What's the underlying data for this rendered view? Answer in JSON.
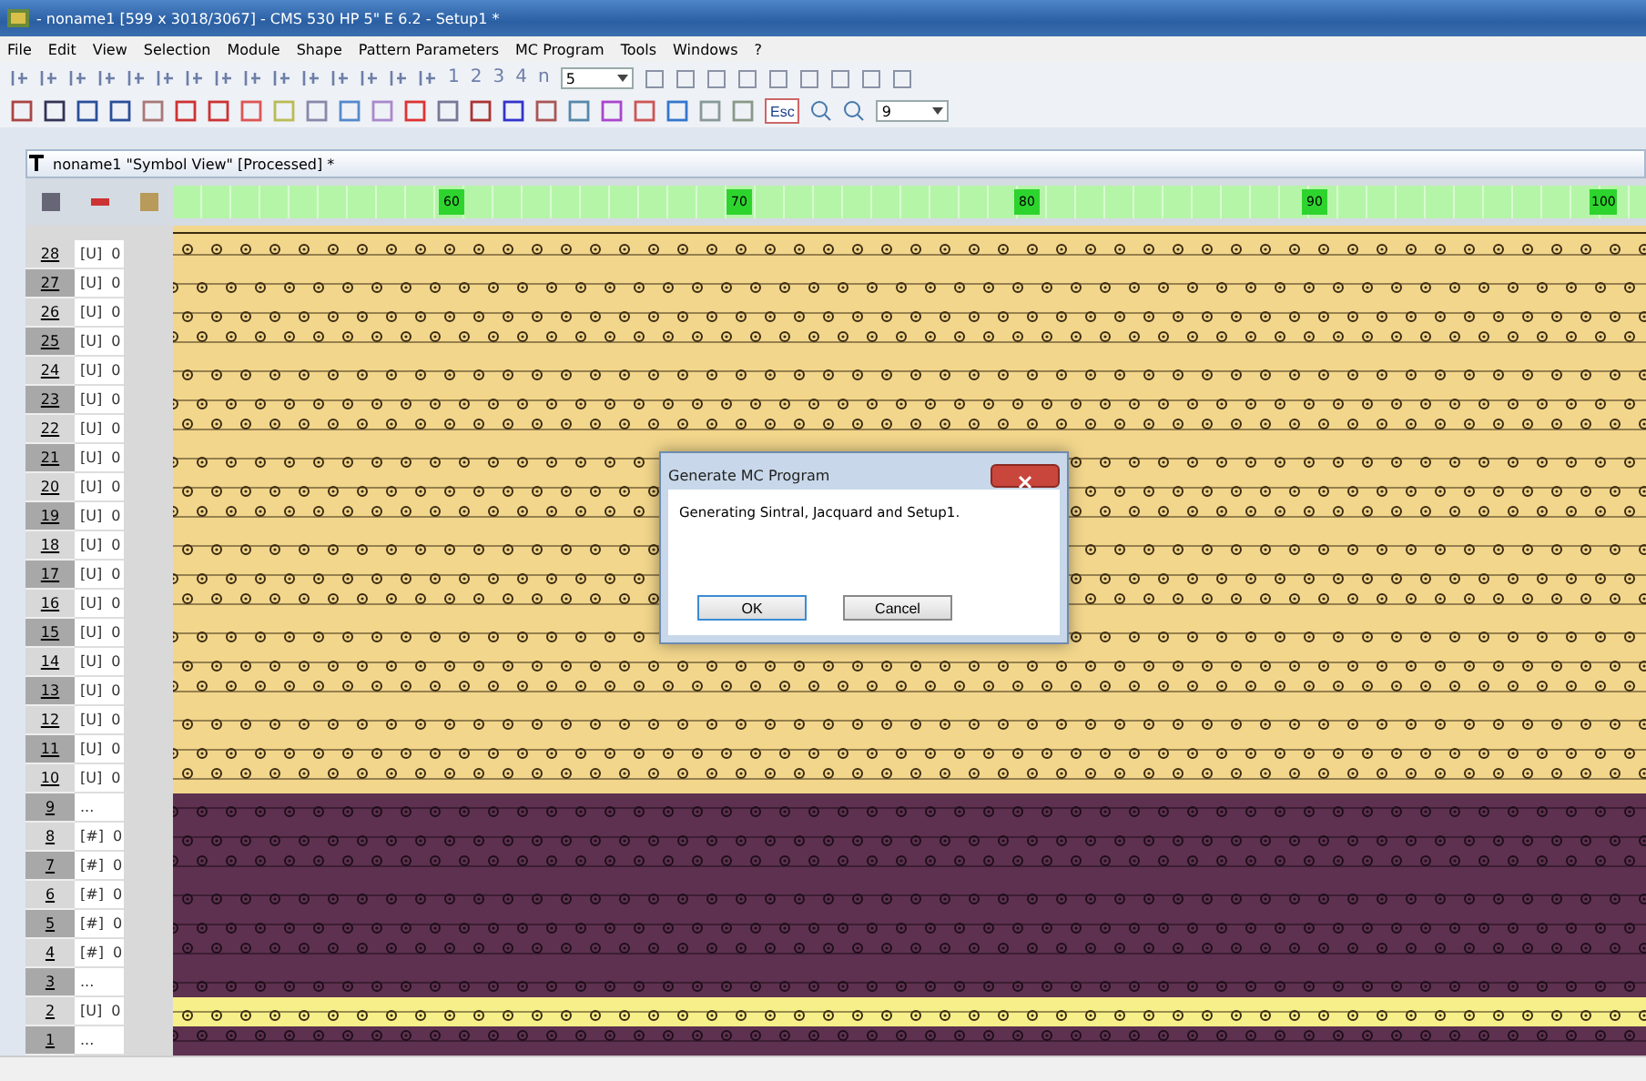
{
  "window": {
    "title": "- noname1 [599 x 3018/3067] - CMS 530 HP 5\" E 6.2 - Setup1 *"
  },
  "menu": [
    "File",
    "Edit",
    "View",
    "Selection",
    "Module",
    "Shape",
    "Pattern Parameters",
    "MC Program",
    "Tools",
    "Windows",
    "?"
  ],
  "toolbar_1": {
    "numbers": [
      "1",
      "2",
      "3",
      "4",
      "n"
    ],
    "combo": "5"
  },
  "toolbar_2": {
    "esc": "Esc",
    "combo": "9"
  },
  "document": {
    "title": "noname1 \"Symbol View\" [Processed] *",
    "ruler": [
      "60",
      "70",
      "80",
      "90",
      "100"
    ],
    "rows": [
      {
        "number": "28",
        "code": "[U]",
        "value": "0",
        "color": "#f2d68c"
      },
      {
        "number": "27",
        "code": "[U]",
        "value": "0",
        "color": "#f2d68c"
      },
      {
        "number": "26",
        "code": "[U]",
        "value": "0",
        "color": "#f2d68c"
      },
      {
        "number": "25",
        "code": "[U]",
        "value": "0",
        "color": "#f2d68c"
      },
      {
        "number": "24",
        "code": "[U]",
        "value": "0",
        "color": "#f2d68c"
      },
      {
        "number": "23",
        "code": "[U]",
        "value": "0",
        "color": "#f2d68c"
      },
      {
        "number": "22",
        "code": "[U]",
        "value": "0",
        "color": "#f2d68c"
      },
      {
        "number": "21",
        "code": "[U]",
        "value": "0",
        "color": "#f2d68c"
      },
      {
        "number": "20",
        "code": "[U]",
        "value": "0",
        "color": "#f2d68c"
      },
      {
        "number": "19",
        "code": "[U]",
        "value": "0",
        "color": "#f2d68c"
      },
      {
        "number": "18",
        "code": "[U]",
        "value": "0",
        "color": "#f2d68c"
      },
      {
        "number": "17",
        "code": "[U]",
        "value": "0",
        "color": "#f2d68c"
      },
      {
        "number": "16",
        "code": "[U]",
        "value": "0",
        "color": "#f2d68c"
      },
      {
        "number": "15",
        "code": "[U]",
        "value": "0",
        "color": "#f2d68c"
      },
      {
        "number": "14",
        "code": "[U]",
        "value": "0",
        "color": "#f2d68c"
      },
      {
        "number": "13",
        "code": "[U]",
        "value": "0",
        "color": "#f2d68c"
      },
      {
        "number": "12",
        "code": "[U]",
        "value": "0",
        "color": "#f2d68c"
      },
      {
        "number": "11",
        "code": "[U]",
        "value": "0",
        "color": "#f2d68c"
      },
      {
        "number": "10",
        "code": "[U]",
        "value": "0",
        "color": "#f2d68c"
      },
      {
        "number": "9",
        "code": "...",
        "color": "#5e3150"
      },
      {
        "number": "8",
        "code": "[#]",
        "value": "0",
        "color": "#5e3150"
      },
      {
        "number": "7",
        "code": "[#]",
        "value": "0",
        "color": "#5e3150"
      },
      {
        "number": "6",
        "code": "[#]",
        "value": "0",
        "color": "#5e3150"
      },
      {
        "number": "5",
        "code": "[#]",
        "value": "0",
        "color": "#5e3150"
      },
      {
        "number": "4",
        "code": "[#]",
        "value": "0",
        "color": "#5e3150"
      },
      {
        "number": "3",
        "code": "...",
        "color": "#5e3150"
      },
      {
        "number": "2",
        "code": "[U]",
        "value": "0",
        "color": "#f7f08a"
      },
      {
        "number": "1",
        "code": "...",
        "color": "#5e3150"
      }
    ]
  },
  "dialog": {
    "title": "Generate MC Program",
    "message": "Generating Sintral, Jacquard and Setup1.",
    "buttons": [
      "OK",
      "Cancel"
    ]
  }
}
